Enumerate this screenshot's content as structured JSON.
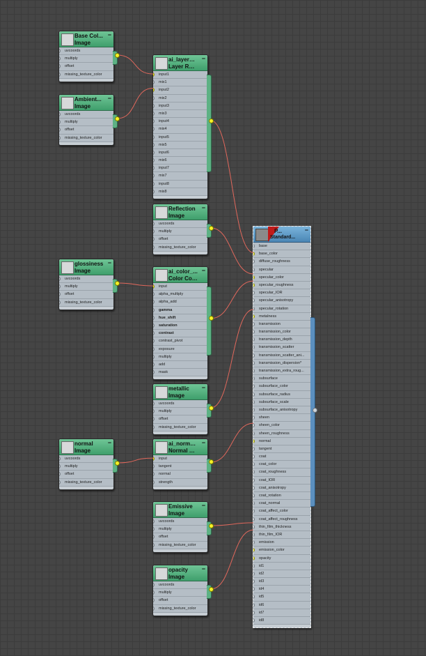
{
  "canvas": {
    "background": "#454545",
    "wire_color": "#e2685c",
    "socket_active": "#f6f228"
  },
  "nodes": [
    {
      "id": "basecolor",
      "title": "Base Col...",
      "subtitle": "Image",
      "kind": "image",
      "rows": [
        "uvcoords",
        "multiply",
        "offset",
        "missing_texture_color"
      ]
    },
    {
      "id": "ambient",
      "title": "Ambient...",
      "subtitle": "Image",
      "kind": "image",
      "rows": [
        "uvcoords",
        "multiply",
        "offset",
        "missing_texture_color"
      ]
    },
    {
      "id": "layer",
      "title": "ai_layer_r...",
      "subtitle": "Layer RG...",
      "kind": "utility",
      "rows": [
        "input1",
        "mix1",
        "input2",
        "mix2",
        "input3",
        "mix3",
        "input4",
        "mix4",
        "input5",
        "mix5",
        "input6",
        "mix6",
        "input7",
        "mix7",
        "input8",
        "mix8"
      ]
    },
    {
      "id": "reflection",
      "title": "Reflection",
      "subtitle": "Image",
      "kind": "image",
      "rows": [
        "uvcoords",
        "multiply",
        "offset",
        "missing_texture_color"
      ]
    },
    {
      "id": "glossiness",
      "title": "glossiness",
      "subtitle": "Image",
      "kind": "image",
      "rows": [
        "uvcoords",
        "multiply",
        "offset",
        "missing_texture_color"
      ]
    },
    {
      "id": "colorcorrect",
      "title": "ai_color_...",
      "subtitle": "Color Cor...",
      "kind": "utility",
      "rows": [
        "input",
        "alpha_multiply",
        "alpha_add",
        "gamma",
        "hue_shift",
        "saturation",
        "contrast",
        "contrast_pivot",
        "exposure",
        "multiply",
        "add",
        "mask"
      ]
    },
    {
      "id": "metallic",
      "title": "metallic",
      "subtitle": "Image",
      "kind": "image",
      "rows": [
        "uvcoords",
        "multiply",
        "offset",
        "missing_texture_color"
      ]
    },
    {
      "id": "normal",
      "title": "normal",
      "subtitle": "Image",
      "kind": "image",
      "rows": [
        "uvcoords",
        "multiply",
        "offset",
        "missing_texture_color"
      ]
    },
    {
      "id": "normalmap",
      "title": "ai_normal...",
      "subtitle": "Normal Map",
      "kind": "utility",
      "rows": [
        "input",
        "tangent",
        "normal",
        "strength"
      ]
    },
    {
      "id": "emissive",
      "title": "Emissive",
      "subtitle": "Image",
      "kind": "image",
      "rows": [
        "uvcoords",
        "multiply",
        "offset",
        "missing_texture_color"
      ]
    },
    {
      "id": "opacity",
      "title": "opacity",
      "subtitle": "Image",
      "kind": "image",
      "rows": [
        "uvcoords",
        "multiply",
        "offset",
        "missing_texture_color"
      ]
    }
  ],
  "material": {
    "title": "P...",
    "subtitle": "Standard...",
    "rows": [
      "base",
      "base_color",
      "diffuse_roughness",
      "specular",
      "specular_color",
      "specular_roughness",
      "specular_IOR",
      "specular_anisotropy",
      "specular_rotation",
      "metalness",
      "transmission",
      "transmission_color",
      "transmission_depth",
      "transmission_scatter",
      "transmission_scatter_ani...",
      "transmission_dispersion*",
      "transmission_extra_roug...",
      "subsurface",
      "subsurface_color",
      "subsurface_radius",
      "subsurface_scale",
      "subsurface_anisotropy",
      "sheen",
      "sheen_color",
      "sheen_roughness",
      "normal",
      "tangent",
      "coat",
      "coat_color",
      "coat_roughness",
      "coat_IOR",
      "coat_anisotropy",
      "coat_rotation",
      "coat_normal",
      "coat_affect_color",
      "coat_affect_roughness",
      "thin_film_thickness",
      "thin_film_IOR",
      "emission",
      "emission_color",
      "opacity",
      "id1",
      "id2",
      "id3",
      "id4",
      "id5",
      "id6",
      "id7",
      "id8"
    ]
  },
  "connections": [
    {
      "from": "basecolor",
      "to": "layer",
      "input": "input1"
    },
    {
      "from": "ambient",
      "to": "layer",
      "input": "input2"
    },
    {
      "from": "layer",
      "to": "material",
      "input": "base_color"
    },
    {
      "from": "reflection",
      "to": "material",
      "input": "specular_color"
    },
    {
      "from": "glossiness",
      "to": "colorcorrect",
      "input": "input"
    },
    {
      "from": "colorcorrect",
      "to": "material",
      "input": "specular_roughness"
    },
    {
      "from": "metallic",
      "to": "material",
      "input": "metalness"
    },
    {
      "from": "normal",
      "to": "normalmap",
      "input": "input"
    },
    {
      "from": "normalmap",
      "to": "material",
      "input": "normal"
    },
    {
      "from": "emissive",
      "to": "material",
      "input": "emission_color"
    },
    {
      "from": "opacity",
      "to": "material",
      "input": "opacity"
    }
  ]
}
